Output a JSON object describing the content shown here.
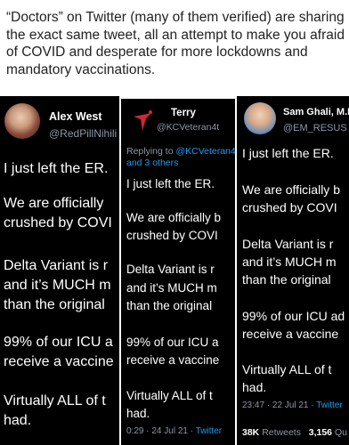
{
  "caption": "“Doctors” on Twitter (many of them verified) are sharing the exact same tweet, all an attempt to make you afraid of COVID and desperate for more lockdowns and mandatory vaccinations.",
  "tweets": [
    {
      "name": "Alex West",
      "handle": "@RedPillNihili",
      "lines": [
        "I just left the ER.",
        "We are officially",
        "crushed by COVI",
        "Delta Variant is r",
        "and it’s MUCH m",
        "than the original",
        "99% of our ICU a",
        "receive a vaccine",
        "Virtually ALL of t",
        "had."
      ]
    },
    {
      "name": "Terry",
      "handle": "@KCVeteran4t",
      "reply_prefix": "Replying to",
      "reply_to": "@KCVeteran4",
      "reply_others": "and 3 others",
      "lines": [
        "I just left the ER.",
        "We are officially b",
        "crushed by COVI",
        "Delta Variant is r",
        "and it’s MUCH m",
        "than the original",
        "99% of our ICU a",
        "receive a vaccine",
        "Virtually ALL of t",
        "had."
      ],
      "timestamp": "0:29 · 24 Jul 21 ·",
      "source": "Twitter"
    },
    {
      "name": "Sam Ghali, M.D",
      "handle": "@EM_RESUS",
      "lines": [
        "I just left the ER.",
        "We are officially b",
        "crushed by COVI",
        "Delta Variant is r",
        "and it’s MUCH m",
        "than the original",
        "99% of our ICU ad",
        "receive a vaccine",
        "Virtually ALL of t",
        "had."
      ],
      "timestamp": "23:47 · 22 Jul 21 ·",
      "source": "Twitter",
      "retweets_count": "38K",
      "retweets_label": "Retweets",
      "quotes_count": "3,156",
      "quotes_label": "Qu"
    }
  ]
}
